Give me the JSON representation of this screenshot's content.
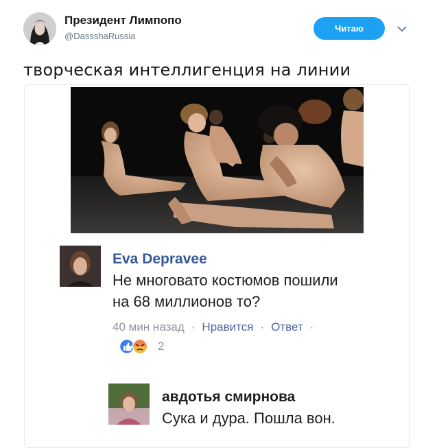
{
  "author": {
    "display_name": "Президент Лимпопо",
    "handle": "@DassshaRussia"
  },
  "follow_button": {
    "label": "Читаю"
  },
  "tweet": {
    "text": "творческая интеллигенция на линии"
  },
  "comments": [
    {
      "author": "Eva Depravee",
      "text_line1": "Не многовато костюмов пошили",
      "text_line2": "на 68 миллионов то?",
      "time": "40 мин назад",
      "like_label": "Нравится",
      "reply_label": "Ответ",
      "reaction_count": "2",
      "reactions": [
        "like-icon",
        "angry-icon"
      ]
    },
    {
      "author": "авдотья смирнова",
      "text_line1": "Сука и дура. Пошла вон."
    }
  ],
  "colors": {
    "accent": "#1da1f2",
    "fb_name": "#365899",
    "meta_gray": "#90949c",
    "like_blue": "#4b67a1"
  }
}
